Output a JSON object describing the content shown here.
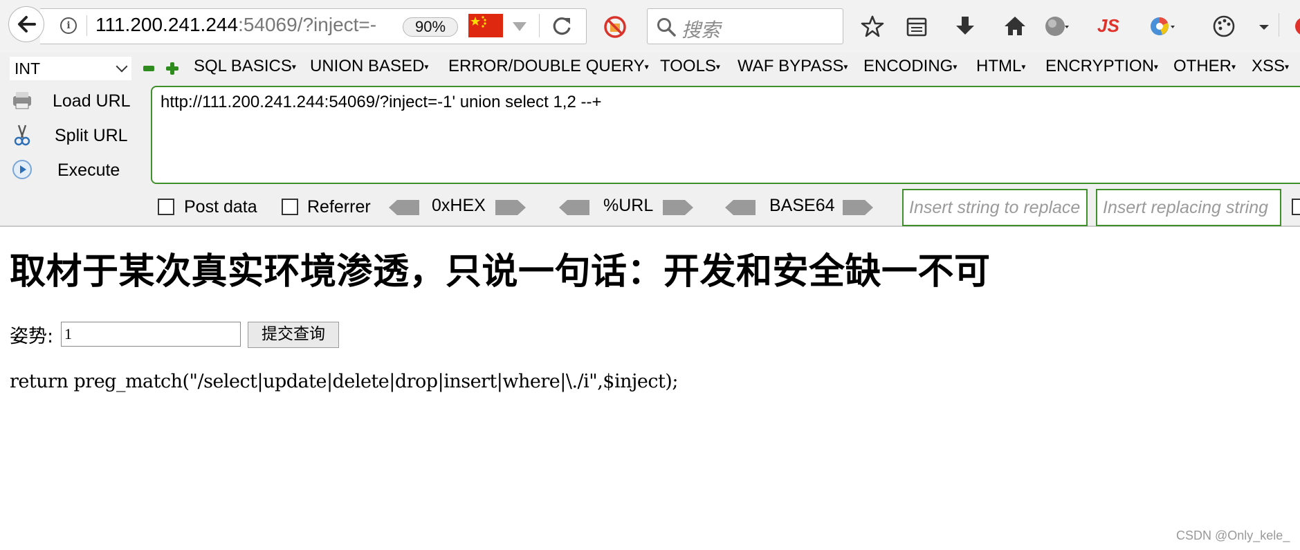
{
  "browser": {
    "url_host": "111.200.241.244",
    "url_rest": ":54069/?inject=-",
    "zoom": "90%",
    "search_placeholder": "搜索",
    "js_badge": "JS"
  },
  "hackbar": {
    "select_value": "INT",
    "menus": [
      "SQL BASICS",
      "UNION BASED",
      "ERROR/DOUBLE QUERY",
      "TOOLS",
      "WAF BYPASS",
      "ENCODING",
      "HTML",
      "ENCRYPTION",
      "OTHER",
      "XSS"
    ],
    "load_url": "Load URL",
    "split_url": "Split URL",
    "execute": "Execute",
    "url_value": "http://111.200.241.244:54069/?inject=-1' union select 1,2 --+",
    "post_data": "Post data",
    "referrer": "Referrer",
    "hex": "0xHEX",
    "url_enc": "%URL",
    "base64": "BASE64",
    "replace_placeholder": "Insert string to replace",
    "replacing_placeholder": "Insert replacing string"
  },
  "page": {
    "title": "取材于某次真实环境渗透，只说一句话：开发和安全缺一不可",
    "form_label": "姿势:",
    "input_value": "1",
    "submit_label": "提交查询",
    "code": "return preg_match(\"/select|update|delete|drop|insert|where|\\./i\",$inject);"
  },
  "watermark": "CSDN @Only_kele_",
  "colors": {
    "accent_green": "#3f8f2a",
    "flag_red": "#de2910"
  }
}
